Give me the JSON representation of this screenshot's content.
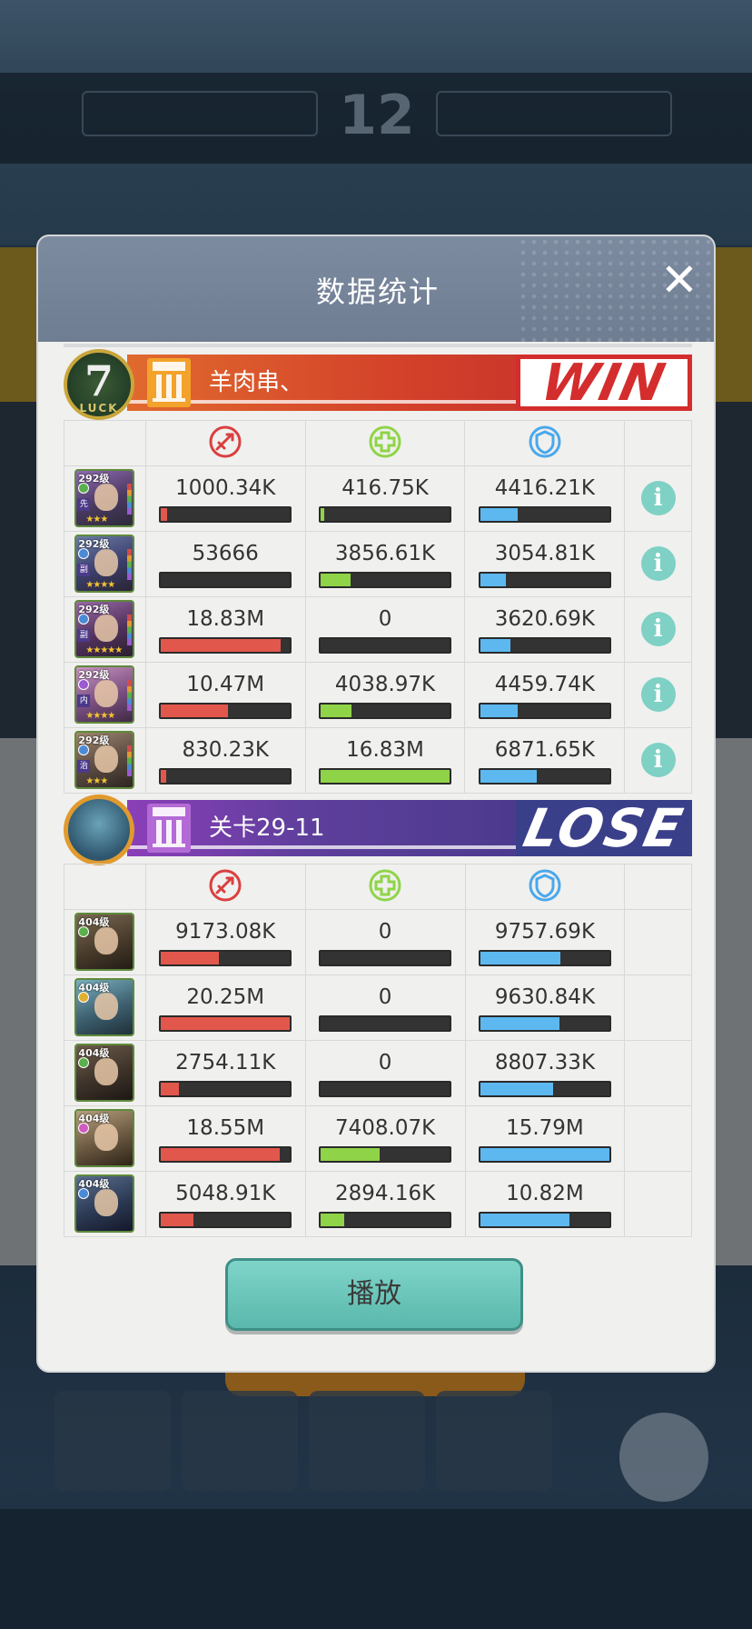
{
  "background": {
    "hud_score": "12"
  },
  "modal": {
    "title": "数据统计",
    "close_label": "✕",
    "play_label": "播放"
  },
  "teams": [
    {
      "name": "羊肉串、",
      "result": "WIN",
      "badge": {
        "number": "7",
        "word": "LUCK"
      },
      "stat_icons": [
        "attack-icon",
        "heal-icon",
        "shield-icon"
      ],
      "heroes": [
        {
          "level": "292级",
          "tag": "先",
          "stars": "★★★",
          "element_color": "#5ab04c",
          "damage": "1000.34K",
          "damage_pct": 0.05,
          "heal": "416.75K",
          "heal_pct": 0.02,
          "defense": "4416.21K",
          "defense_pct": 0.29
        },
        {
          "level": "292级",
          "tag": "副",
          "stars": "★★★★",
          "element_color": "#4a8ad6",
          "damage": "53666",
          "damage_pct": 0.0,
          "heal": "3856.61K",
          "heal_pct": 0.23,
          "defense": "3054.81K",
          "defense_pct": 0.2
        },
        {
          "level": "292级",
          "tag": "副",
          "stars": "★★★★★",
          "element_color": "#4a8ad6",
          "damage": "18.83M",
          "damage_pct": 0.93,
          "heal": "0",
          "heal_pct": 0.0,
          "defense": "3620.69K",
          "defense_pct": 0.23
        },
        {
          "level": "292级",
          "tag": "内",
          "stars": "★★★★",
          "element_color": "#9a5ad0",
          "damage": "10.47M",
          "damage_pct": 0.52,
          "heal": "4038.97K",
          "heal_pct": 0.24,
          "defense": "4459.74K",
          "defense_pct": 0.29
        },
        {
          "level": "292级",
          "tag": "治",
          "stars": "★★★",
          "element_color": "#4a8ad6",
          "damage": "830.23K",
          "damage_pct": 0.04,
          "heal": "16.83M",
          "heal_pct": 1.0,
          "defense": "6871.65K",
          "defense_pct": 0.44
        }
      ]
    },
    {
      "name": "关卡29-11",
      "result": "LOSE",
      "stat_icons": [
        "attack-icon",
        "heal-icon",
        "shield-icon"
      ],
      "heroes": [
        {
          "level": "404级",
          "element_color": "#5ab04c",
          "damage": "9173.08K",
          "damage_pct": 0.45,
          "heal": "0",
          "heal_pct": 0.0,
          "defense": "9757.69K",
          "defense_pct": 0.62
        },
        {
          "level": "404级",
          "element_color": "#e0b030",
          "damage": "20.25M",
          "damage_pct": 1.0,
          "heal": "0",
          "heal_pct": 0.0,
          "defense": "9630.84K",
          "defense_pct": 0.61
        },
        {
          "level": "404级",
          "element_color": "#5ab04c",
          "damage": "2754.11K",
          "damage_pct": 0.14,
          "heal": "0",
          "heal_pct": 0.0,
          "defense": "8807.33K",
          "defense_pct": 0.56
        },
        {
          "level": "404级",
          "element_color": "#d05ac0",
          "damage": "18.55M",
          "damage_pct": 0.92,
          "heal": "7408.07K",
          "heal_pct": 0.46,
          "defense": "15.79M",
          "defense_pct": 1.0
        },
        {
          "level": "404级",
          "element_color": "#4a8ad6",
          "damage": "5048.91K",
          "damage_pct": 0.25,
          "heal": "2894.16K",
          "heal_pct": 0.18,
          "defense": "10.82M",
          "defense_pct": 0.69
        }
      ]
    }
  ],
  "colors": {
    "damage_bar": "#e2574c",
    "heal_bar": "#8fd448",
    "defense_bar": "#5db8f0",
    "info_button": "#7ed1c4",
    "play_button": "#6cc6ba"
  }
}
